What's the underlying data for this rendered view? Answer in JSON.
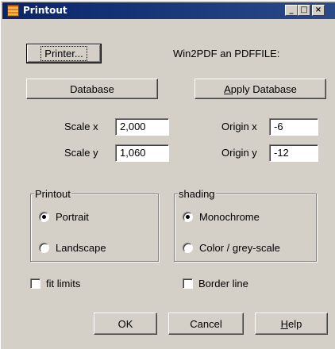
{
  "window": {
    "title": "Printout"
  },
  "titlebar_buttons": {
    "minimize": "_",
    "maximize": "□",
    "close": "×"
  },
  "printer": {
    "button_label": "Printer...",
    "status": "Win2PDF an PDFFILE:"
  },
  "database": {
    "button_label": "Database",
    "apply_label_pre": "",
    "apply_label_accel": "A",
    "apply_label_post": "pply Database"
  },
  "scale": {
    "x_label": "Scale x",
    "x_value": "2,000",
    "y_label": "Scale y",
    "y_value": "1,060"
  },
  "origin": {
    "x_label": "Origin x",
    "x_value": "-6",
    "y_label": "Origin y",
    "y_value": "-12"
  },
  "printout_group": {
    "title": "Printout",
    "options": [
      {
        "label": "Portrait",
        "selected": true
      },
      {
        "label": "Landscape",
        "selected": false
      }
    ]
  },
  "shading_group": {
    "title": "shading",
    "options": [
      {
        "label": "Monochrome",
        "selected": true
      },
      {
        "label": "Color / grey-scale",
        "selected": false
      }
    ]
  },
  "checkboxes": {
    "fit_limits": "fit limits",
    "border_line": "Border line"
  },
  "footer": {
    "ok": "OK",
    "cancel": "Cancel",
    "help_accel": "H",
    "help_rest": "elp"
  }
}
